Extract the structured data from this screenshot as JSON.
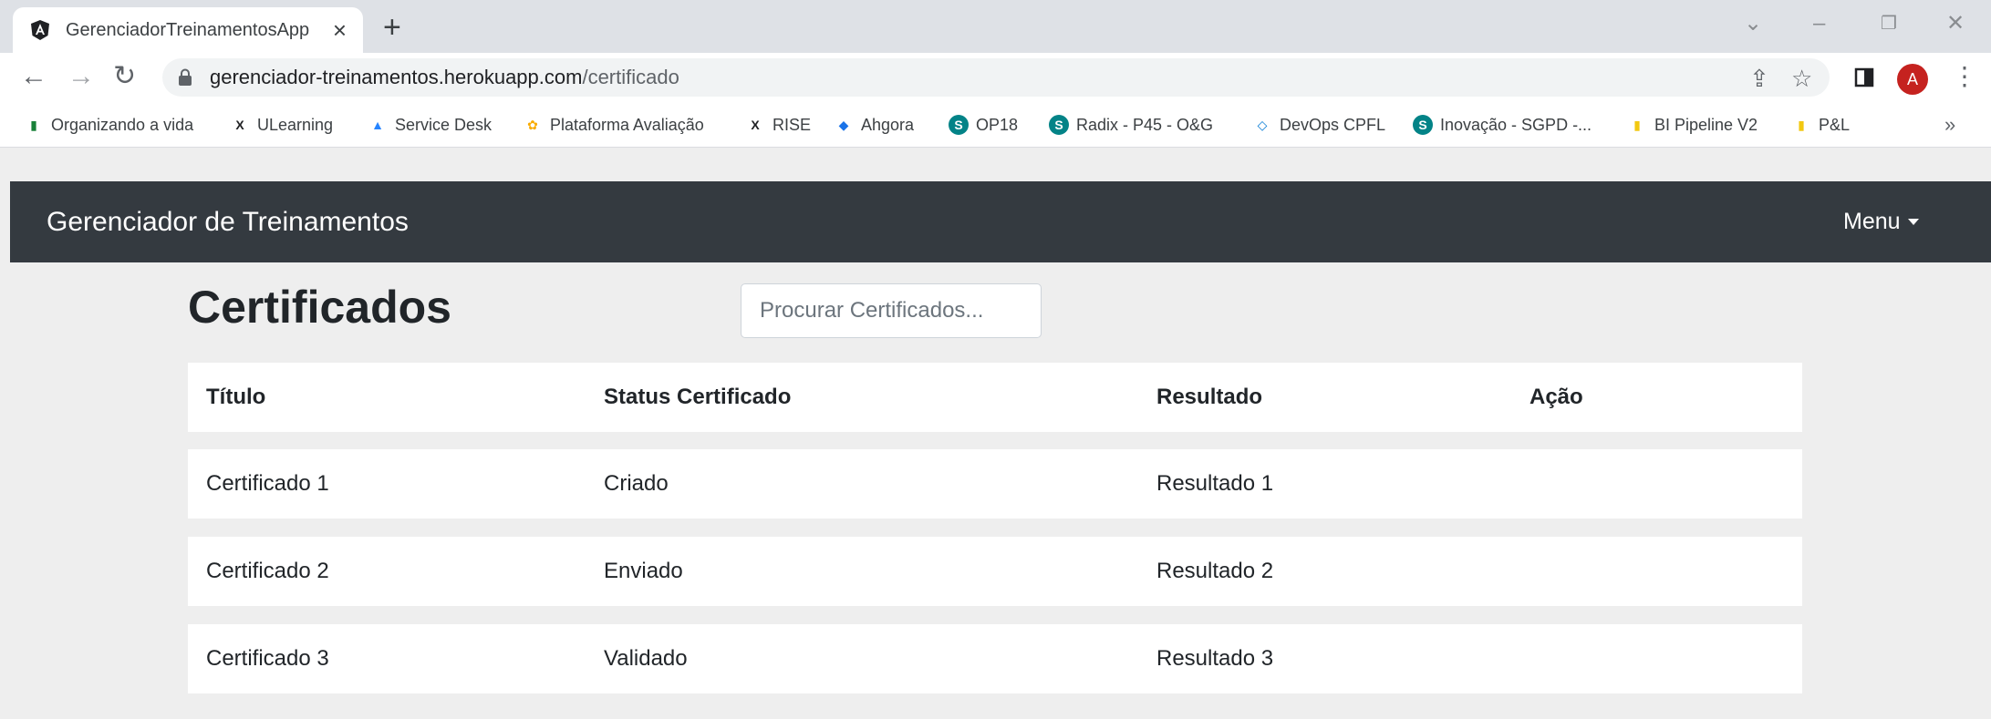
{
  "browser": {
    "tab_title": "GerenciadorTreinamentosApp",
    "url_host": "gerenciador-treinamentos.herokuapp.com",
    "url_path": "/certificado",
    "profile_initial": "A",
    "bookmarks": [
      {
        "label": "Organizando a vida",
        "icon": "flag-icon",
        "color": "#188038"
      },
      {
        "label": "ULearning",
        "icon": "x-logo-icon",
        "color": "#202124"
      },
      {
        "label": "Service Desk",
        "icon": "jira-icon",
        "color": "#2684ff"
      },
      {
        "label": "Plataforma Avaliação",
        "icon": "avaliacao-icon",
        "color": "#f9ab00"
      },
      {
        "label": "RISE",
        "icon": "x-logo-icon",
        "color": "#202124"
      },
      {
        "label": "Ahgora",
        "icon": "ahgora-icon",
        "color": "#1a73e8"
      },
      {
        "label": "OP18",
        "icon": "sharepoint-icon",
        "color": "#038387"
      },
      {
        "label": "Radix - P45 - O&G",
        "icon": "sharepoint-icon",
        "color": "#038387"
      },
      {
        "label": "DevOps CPFL",
        "icon": "azure-devops-icon",
        "color": "#0078d4"
      },
      {
        "label": "Inovação - SGPD -...",
        "icon": "sharepoint-icon",
        "color": "#038387"
      },
      {
        "label": "BI Pipeline V2",
        "icon": "powerbi-icon",
        "color": "#f2c811"
      },
      {
        "label": "P&L",
        "icon": "powerbi-icon",
        "color": "#f2c811"
      }
    ]
  },
  "app": {
    "brand": "Gerenciador de Treinamentos",
    "menu_label": "Menu",
    "page_title": "Certificados",
    "search_placeholder": "Procurar Certificados...",
    "table": {
      "headers": [
        "Título",
        "Status Certificado",
        "Resultado",
        "Ação"
      ],
      "rows": [
        [
          "Certificado 1",
          "Criado",
          "Resultado 1",
          ""
        ],
        [
          "Certificado 2",
          "Enviado",
          "Resultado 2",
          ""
        ],
        [
          "Certificado 3",
          "Validado",
          "Resultado 3",
          ""
        ]
      ]
    }
  },
  "colors": {
    "navbar": "#343a40",
    "page_background": "#eeeeee",
    "tabstrip": "#dee1e6"
  }
}
